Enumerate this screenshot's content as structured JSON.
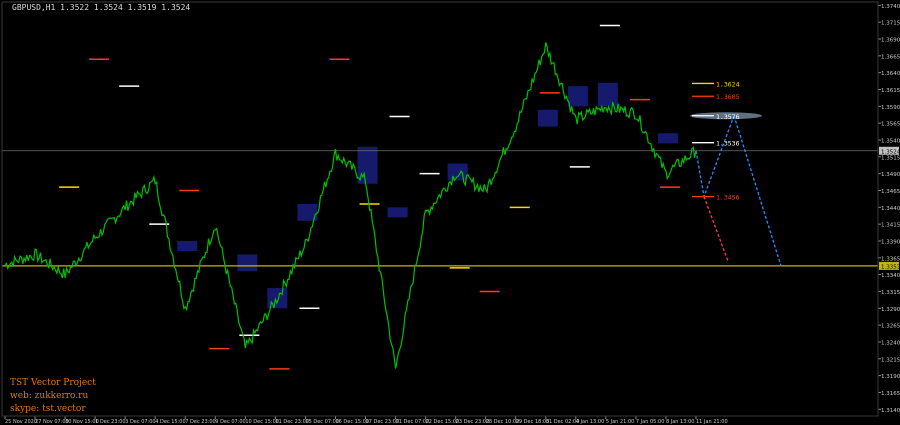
{
  "header": {
    "symbol_info": "GBPUSD,H1  1.3522 1.3524 1.3519 1.3524"
  },
  "watermark": {
    "line1": "TST Vector Project",
    "line2": "web: zukkerro.ru",
    "line3": "skype: tst.vector"
  },
  "colors": {
    "background": "#000000",
    "candles": "#00c000",
    "zone_fill": "#1a1f80",
    "support_yellow": "#c8b400",
    "current_price_line": "#707070",
    "level_red": "#ff3b10",
    "level_white": "#ffffff",
    "level_yellow": "#ffd700",
    "projection_red": "#ff3b3b",
    "projection_blue": "#1e90ff",
    "target_ellipse": "#607080"
  },
  "chart_data": {
    "type": "line",
    "title": "GBPUSD,H1",
    "x": [
      "25 Nov 2020",
      "27 Nov 07:00",
      "30 Nov 15:00",
      "1 Dec 23:00",
      "3 Dec 07:00",
      "4 Dec 15:00",
      "7 Dec 23:00",
      "9 Dec 07:00",
      "10 Dec 15:00",
      "11 Dec 23:00",
      "15 Dec 07:00",
      "16 Dec 15:00",
      "17 Dec 23:00",
      "21 Dec 07:00",
      "22 Dec 15:00",
      "23 Dec 23:00",
      "28 Dec 10:00",
      "29 Dec 18:00",
      "31 Dec 02:00",
      "4 Jan 13:00",
      "5 Jan 21:00",
      "7 Jan 05:00",
      "8 Jan 13:00",
      "11 Jan 21:00"
    ],
    "series": [
      {
        "values": [
          1.3355,
          1.337,
          1.334,
          1.3395,
          1.344,
          1.348,
          1.329,
          1.3415,
          1.323,
          1.33,
          1.3385,
          1.352,
          1.348,
          1.32,
          1.343,
          1.349,
          1.3465,
          1.356,
          1.368,
          1.357,
          1.359,
          1.358,
          1.349,
          1.3524
        ]
      }
    ],
    "y_ticks": [
      "1.3740",
      "1.3715",
      "1.3690",
      "1.3665",
      "1.3640",
      "1.3615",
      "1.3590",
      "1.3565",
      "1.3540",
      "1.3524",
      "1.3515",
      "1.3490",
      "1.3465",
      "1.3440",
      "1.3415",
      "1.3390",
      "1.3365",
      "1.3353",
      "1.3340",
      "1.3315",
      "1.3290",
      "1.3265",
      "1.3240",
      "1.3215",
      "1.3190",
      "1.3165",
      "1.3140"
    ],
    "ylim": [
      1.313,
      1.3745
    ],
    "current_price": 1.3524,
    "support_level": 1.3353,
    "level_tags": [
      "1.3624",
      "1.3605",
      "1.3576",
      "1.3536",
      "1.3456",
      "1.3524",
      "1.3353"
    ],
    "grid": false
  }
}
